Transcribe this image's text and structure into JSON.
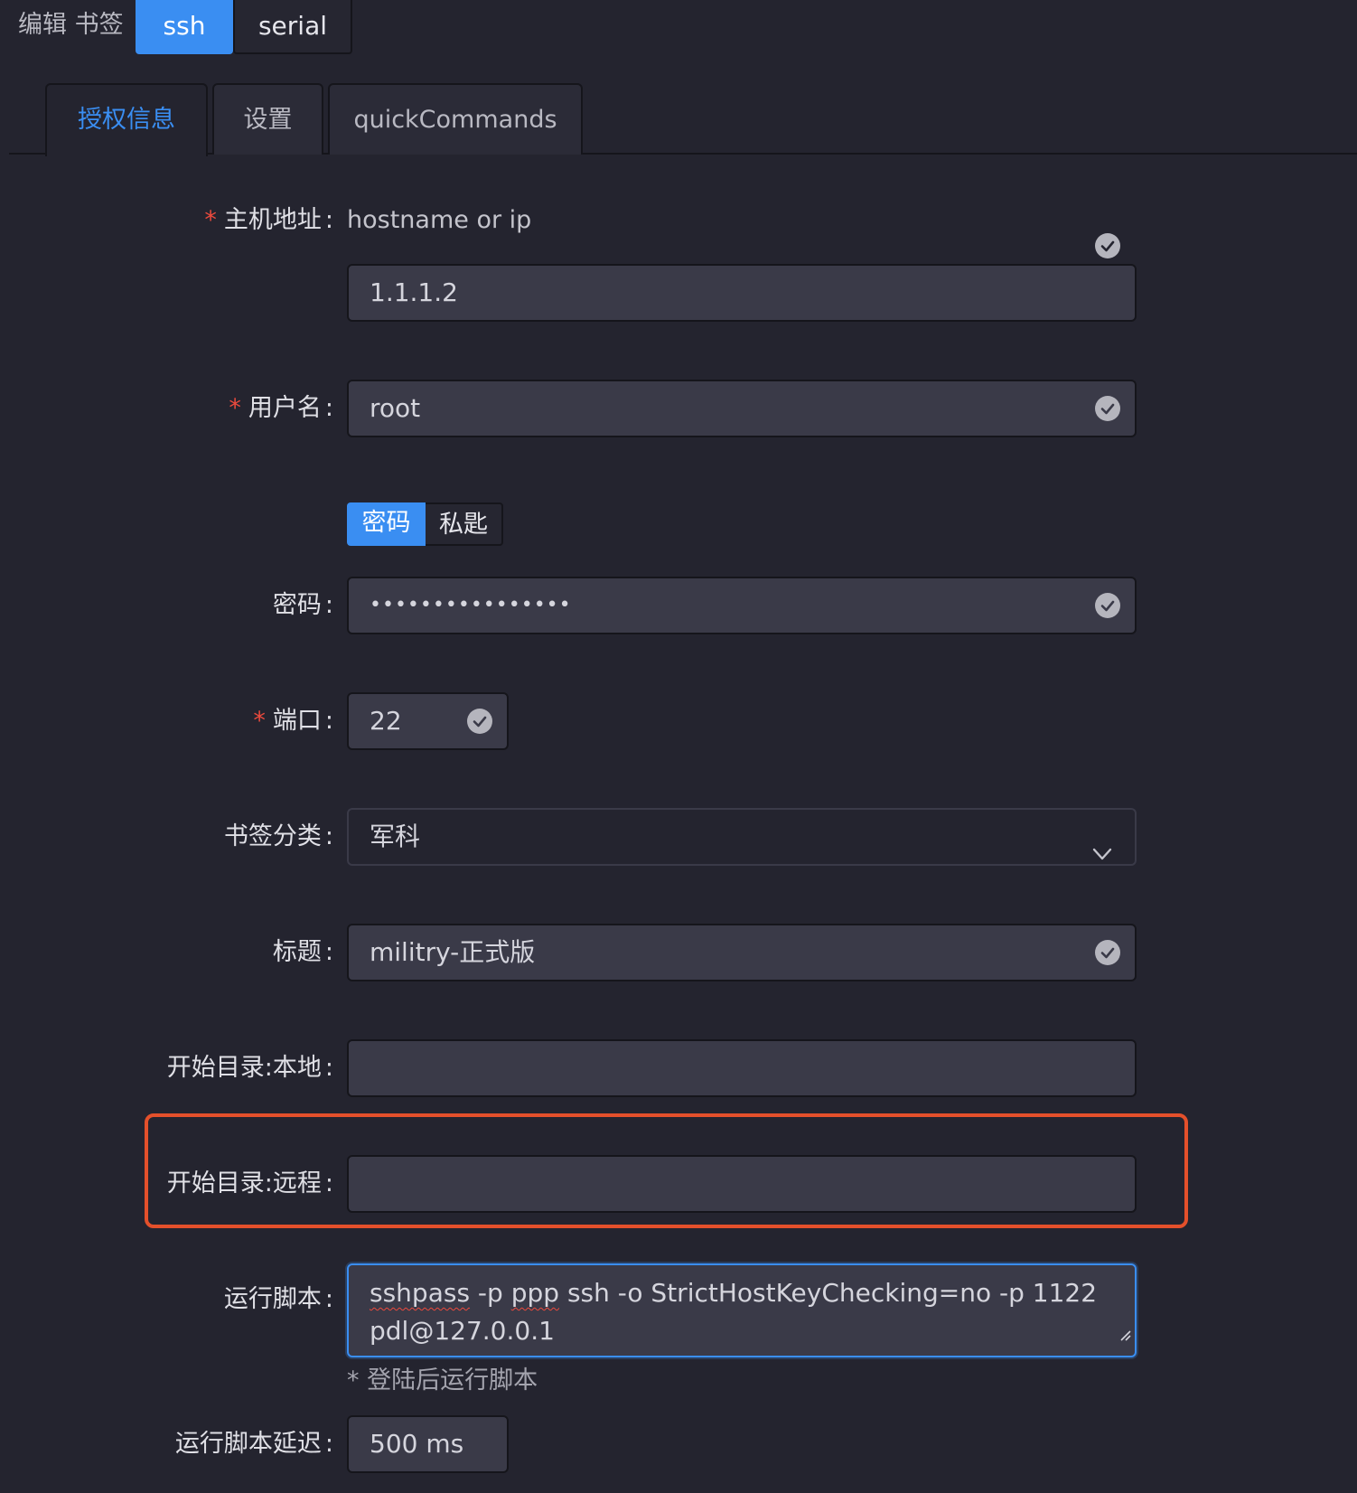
{
  "header": {
    "title": "编辑 书签",
    "type_tabs": [
      {
        "label": "ssh",
        "active": true
      },
      {
        "label": "serial",
        "active": false
      }
    ]
  },
  "sub_tabs": [
    {
      "label": "授权信息",
      "active": true
    },
    {
      "label": "设置",
      "active": false
    },
    {
      "label": "quickCommands",
      "active": false
    }
  ],
  "form": {
    "required_mark": "*",
    "colon": ":",
    "host": {
      "label": "主机地址",
      "hint": "hostname or ip",
      "value": "1.1.1.2"
    },
    "username": {
      "label": "用户名",
      "value": "root"
    },
    "auth_mode": {
      "options": [
        "密码",
        "私匙"
      ],
      "selected": "密码"
    },
    "password": {
      "label": "密码",
      "value": "••••••••••••••••"
    },
    "port": {
      "label": "端口",
      "value": "22"
    },
    "category": {
      "label": "书签分类",
      "value": "军科"
    },
    "title": {
      "label": "标题",
      "value": "militry-正式版"
    },
    "start_dir_local": {
      "label": "开始目录:本地",
      "value": ""
    },
    "start_dir_remote": {
      "label": "开始目录:远程",
      "value": ""
    },
    "run_script": {
      "label": "运行脚本",
      "value_parts": [
        "sshpass",
        " -p ",
        "ppp",
        " ssh -o StrictHostKeyChecking=no -p 1122 pdl@127.0.0.1"
      ],
      "help": "* 登陆后运行脚本"
    },
    "run_script_delay": {
      "label": "运行脚本延迟",
      "value": "500 ms"
    }
  },
  "colors": {
    "accent": "#3a8ef2",
    "highlight_box": "#e4502b",
    "required": "#ec4a3d"
  }
}
